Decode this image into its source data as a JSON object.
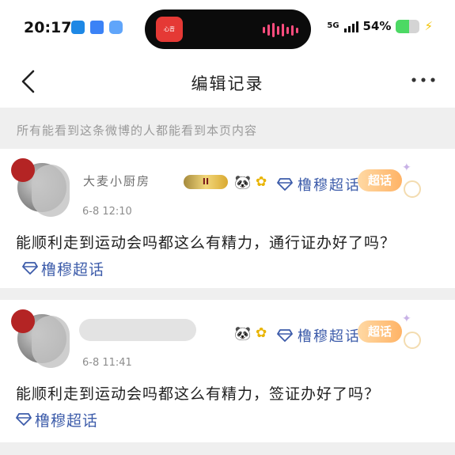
{
  "status_bar": {
    "time": "20:17",
    "network": "5G",
    "battery_percent": "54%",
    "battery_level": 0.54,
    "island_app_label": "心音"
  },
  "nav": {
    "title": "编辑记录"
  },
  "notice": "所有能看到这条微博的人都能看到本页内容",
  "records": [
    {
      "username": "大麦小厨房",
      "level_badge": "II",
      "topic_tag": "橹穆超话",
      "super_badge": "超话",
      "timestamp": "6-8 12:10",
      "text": "能顺利走到运动会吗都这么有精力，通行证办好了吗？",
      "inline_topic": "橹穆超话"
    },
    {
      "username": "",
      "level_badge": "",
      "topic_tag": "橹穆超话",
      "super_badge": "超话",
      "timestamp": "6-8 11:41",
      "text": "能顺利走到运动会吗都这么有精力，签证办好了吗？",
      "inline_topic": "橹穆超话"
    }
  ],
  "colors": {
    "topic_blue": "#3d5caa",
    "background": "#efefef",
    "battery_green": "#4cd964"
  },
  "icons": {
    "back": "chevron-left-icon",
    "more": "more-dots-icon",
    "topic": "diamond-icon"
  }
}
